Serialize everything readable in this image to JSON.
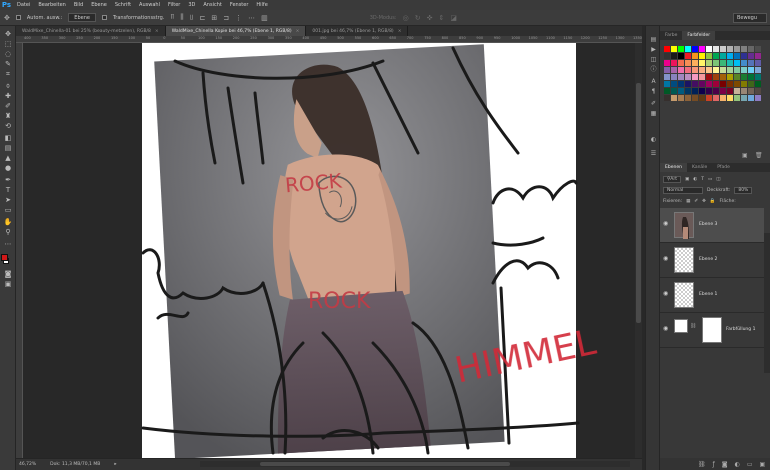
{
  "app": {
    "logo": "Ps"
  },
  "menu": [
    "Datei",
    "Bearbeiten",
    "Bild",
    "Ebene",
    "Schrift",
    "Auswahl",
    "Filter",
    "3D",
    "Ansicht",
    "Fenster",
    "Hilfe"
  ],
  "options": {
    "auto_select_label": "Autom. ausw.:",
    "auto_select_target": "Ebene",
    "transform_label": "Transformationsstrg.",
    "mode_3d_label": "3D-Modus:",
    "workspace": "Bewegu"
  },
  "tabs": [
    {
      "label": "WaldMixe_Chinella-01 bei 25% (beauty-metzelen), RGB/8",
      "active": false
    },
    {
      "label": "WaldMixe_Chinella Kopie bei 46,7% (Ebene 1, RGB/8)",
      "active": true
    },
    {
      "label": "001.jpg bei 46,7% (Ebene 1, RGB/8)",
      "active": false
    }
  ],
  "ruler_top": [
    "400",
    "350",
    "300",
    "250",
    "200",
    "150",
    "100",
    "50",
    "0",
    "50",
    "100",
    "150",
    "200",
    "250",
    "300",
    "350",
    "400",
    "450",
    "500",
    "550",
    "600",
    "650",
    "700",
    "750",
    "800",
    "850",
    "900",
    "950",
    "1000",
    "1050",
    "1100",
    "1150",
    "1200",
    "1250",
    "1300",
    "1350"
  ],
  "status": {
    "zoom": "46,72%",
    "doc": "Dok: 11,3 MB/70,1 MB"
  },
  "swatch_panel": {
    "tabs": [
      "Farbe",
      "Farbfelder"
    ],
    "active": "Farbfelder"
  },
  "layers_panel": {
    "tabs": [
      "Ebenen",
      "Kanäle",
      "Pfade"
    ],
    "filter_label": "Art",
    "blend_mode": "Normal",
    "opacity_label": "Deckkraft:",
    "opacity": "80%",
    "fix_label": "Fixieren:",
    "fill_label": "Fläche:",
    "layers": [
      {
        "name": "Ebene 3",
        "active": true
      },
      {
        "name": "Ebene 2",
        "active": false
      },
      {
        "name": "Ebene 1",
        "active": false
      },
      {
        "name": "Farbfüllung 1",
        "active": false
      }
    ]
  },
  "canvas_text": {
    "word1": "ROCK",
    "word2": "HIMMEL",
    "word3": "ROCK"
  },
  "colors": {
    "fg": "#d01818",
    "bg": "#ffffff",
    "accent": "#31a8ff"
  }
}
